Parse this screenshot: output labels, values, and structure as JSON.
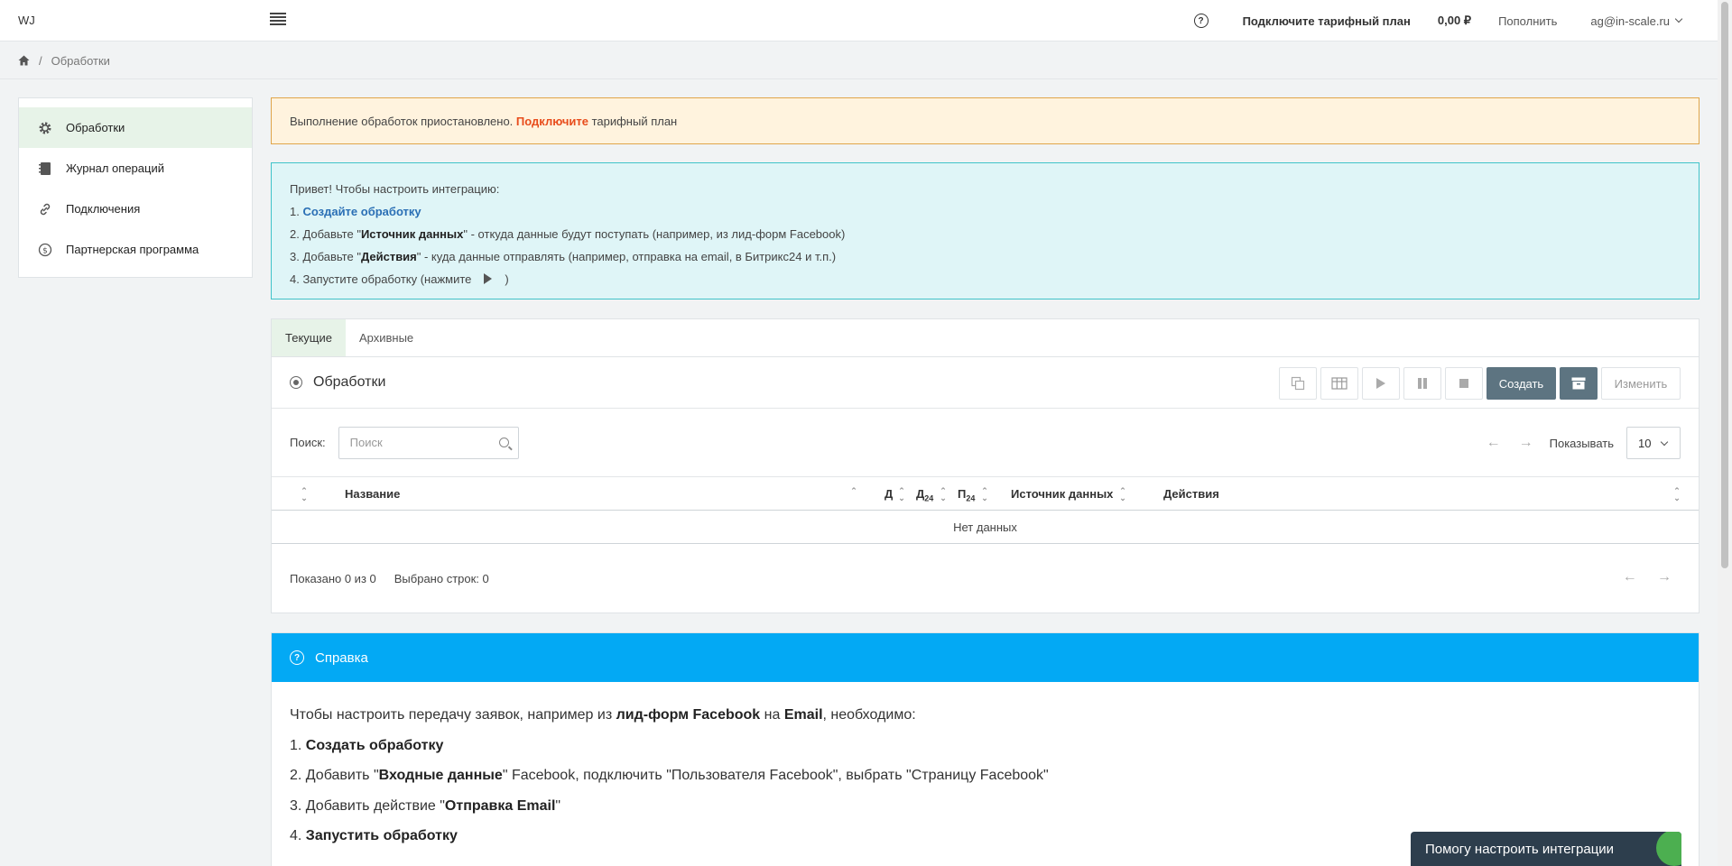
{
  "header": {
    "logo": "WJ",
    "plan_label": "Подключите тарифный план",
    "balance": "0,00 ₽",
    "topup_label": "Пополнить",
    "user_email": "ag@in-scale.ru"
  },
  "breadcrumb": {
    "current": "Обработки"
  },
  "sidebar": {
    "items": [
      {
        "label": "Обработки",
        "icon": "gear-icon"
      },
      {
        "label": "Журнал операций",
        "icon": "journal-icon"
      },
      {
        "label": "Подключения",
        "icon": "link-icon"
      },
      {
        "label": "Партнерская программа",
        "icon": "dollar-icon"
      }
    ]
  },
  "warning": {
    "text": "Выполнение обработок приостановлено.",
    "link": "Подключите",
    "suffix": "тарифный план"
  },
  "intro": {
    "greeting": "Привет! Чтобы настроить интеграцию:",
    "step1_prefix": "1.",
    "step1_link": "Создайте обработку",
    "step2_prefix": "2. Добавьте \"",
    "step2_bold": "Источник данных",
    "step2_suffix": "\" - откуда данные будут поступать (например, из лид-форм Facebook)",
    "step3_prefix": "3. Добавьте \"",
    "step3_bold": "Действия",
    "step3_suffix": "\" - куда данные отправлять (например, отправка на email, в Битрикс24 и т.п.)",
    "step4_prefix": "4. Запустите обработку  (нажмите",
    "step4_suffix": ")"
  },
  "tabs": [
    {
      "label": "Текущие"
    },
    {
      "label": "Архивные"
    }
  ],
  "panel": {
    "title": "Обработки",
    "create_label": "Создать",
    "edit_label": "Изменить"
  },
  "search": {
    "label": "Поиск:",
    "placeholder": "Поиск"
  },
  "pager": {
    "show_label": "Показывать",
    "page_size": "10"
  },
  "table": {
    "columns": {
      "name": "Название",
      "d": "Д",
      "d24": "Д",
      "d24_sub": "24",
      "p24": "П",
      "p24_sub": "24",
      "source": "Источник данных",
      "actions": "Действия"
    },
    "empty": "Нет данных",
    "shown": "Показано 0 из 0",
    "selected": "Выбрано строк: 0"
  },
  "help": {
    "title": "Справка",
    "intro_prefix": "Чтобы настроить передачу заявок, например из",
    "intro_bold1": "лид-форм Facebook",
    "intro_mid": "на",
    "intro_bold2": "Email",
    "intro_suffix": ", необходимо:",
    "s1_prefix": "1.",
    "s1_bold": "Создать обработку",
    "s2_prefix": "2. Добавить \"",
    "s2_bold": "Входные данные",
    "s2_suffix": "\" Facebook, подключить \"Пользователя Facebook\", выбрать \"Страницу Facebook\"",
    "s3_prefix": "3. Добавить действие \"",
    "s3_bold": "Отправка Email",
    "s3_suffix": "\"",
    "s4_prefix": "4.",
    "s4_bold": "Запустить обработку"
  },
  "chat": {
    "label": "Помогу настроить интеграции"
  },
  "colors": {
    "accent": "#03a9f4",
    "active_bg": "#e7f3e8",
    "warning_link": "#e84c1b",
    "button_dark": "#5d7481"
  }
}
